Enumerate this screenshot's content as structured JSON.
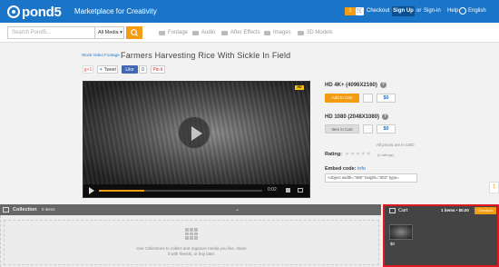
{
  "header": {
    "logo": "pond5",
    "tagline": "Marketplace for Creativity",
    "cart_count": "1",
    "checkout": "Checkout",
    "signup": "Sign Up",
    "or": "or",
    "signin": "Sign-in",
    "help": "Help",
    "language": "English"
  },
  "search": {
    "placeholder": "Search Pond5...",
    "media_type": "All Media",
    "categories": [
      "Footage",
      "Audio",
      "After Effects",
      "Images",
      "3D Models"
    ]
  },
  "breadcrumb": "Stock Video Footage",
  "page_title": "Farmers Harvesting Rice With Sickle In Field",
  "share": {
    "gplus": "g+1",
    "tweet": "Tweet",
    "like": "Like",
    "like_count": "0",
    "pin": "Pin it"
  },
  "player": {
    "time": "0:02",
    "progress_fraction": 0.28
  },
  "purchase": {
    "hd4k_label": "HD 4K+ (4096X2160)",
    "add_to_cart": "Add to Cart",
    "hd4k_price": "$0",
    "hd1080_label": "HD 1080 (2048X1080)",
    "item_in_cart": "Item in Cart",
    "hd1080_price": "$0",
    "usd_note": "All prices are in USD.",
    "rating_label": "Rating:",
    "stars": "★★★★★",
    "rating_count": "(0 ratings)",
    "embed_label": "Embed code:",
    "embed_info": "info",
    "embed_code": "<object width=\"480\" height=\"303\" type="
  },
  "collection": {
    "title": "Collection",
    "count": "0 items",
    "message": "Use Collections to collect and organize media you like, share it with friends, or buy later."
  },
  "cart": {
    "title": "Cart",
    "summary": "1 items • $0.00",
    "checkout": "Checkout",
    "item_price": "$0"
  },
  "colors": {
    "brand_blue": "#1a75c9",
    "accent_orange": "#f39c12",
    "highlight_red": "#e0171f"
  }
}
